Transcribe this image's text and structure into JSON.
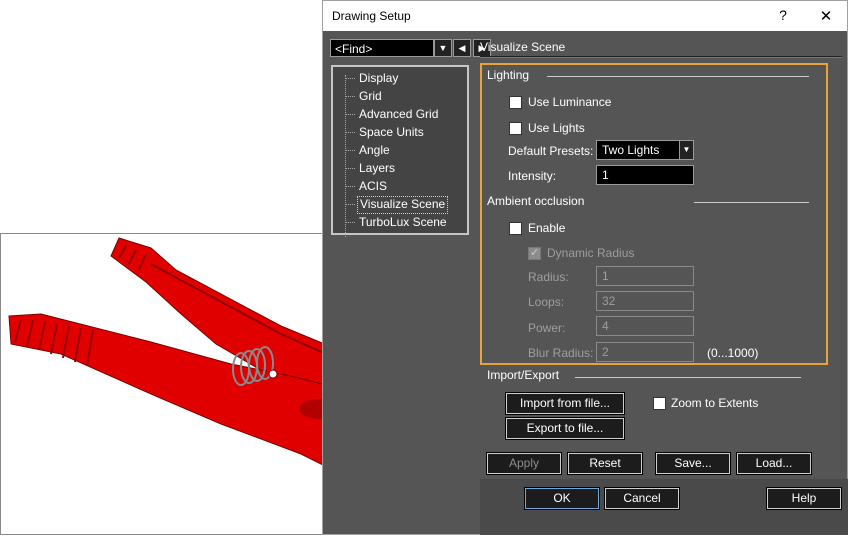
{
  "dialog": {
    "title": "Drawing Setup",
    "help_glyph": "?",
    "close_glyph": "✕",
    "find": {
      "value": "<Find>"
    },
    "tree": [
      "Display",
      "Grid",
      "Advanced Grid",
      "Space Units",
      "Angle",
      "Layers",
      "ACIS",
      "Visualize Scene",
      "TurboLux Scene"
    ],
    "selected_tree_item": "Visualize Scene",
    "section_title": "Visualize Scene",
    "lighting": {
      "label": "Lighting",
      "use_luminance": {
        "label": "Use Luminance",
        "checked": false
      },
      "use_lights": {
        "label": "Use Lights",
        "checked": false
      },
      "default_presets": {
        "label": "Default Presets:",
        "value": "Two Lights"
      },
      "intensity": {
        "label": "Intensity:",
        "value": "1"
      }
    },
    "ambient": {
      "label": "Ambient occlusion",
      "enable": {
        "label": "Enable",
        "checked": false
      },
      "dynamic_radius": {
        "label": "Dynamic Radius",
        "checked": true
      },
      "radius": {
        "label": "Radius:",
        "value": "1"
      },
      "loops": {
        "label": "Loops:",
        "value": "32"
      },
      "power": {
        "label": "Power:",
        "value": "4"
      },
      "blur_radius": {
        "label": "Blur Radius:",
        "value": "2",
        "range": "(0...1000)"
      }
    },
    "import_export": {
      "label": "Import/Export",
      "import_btn": "Import from file...",
      "export_btn": "Export to file...",
      "zoom_to_extents": {
        "label": "Zoom to Extents",
        "checked": false
      }
    },
    "buttons": {
      "apply": "Apply",
      "reset": "Reset",
      "save": "Save...",
      "load": "Load...",
      "ok": "OK",
      "cancel": "Cancel",
      "help": "Help"
    }
  },
  "colors": {
    "dialog_bg": "#555555",
    "highlight_border": "#e8a33d",
    "clip_red": "#e00000"
  }
}
